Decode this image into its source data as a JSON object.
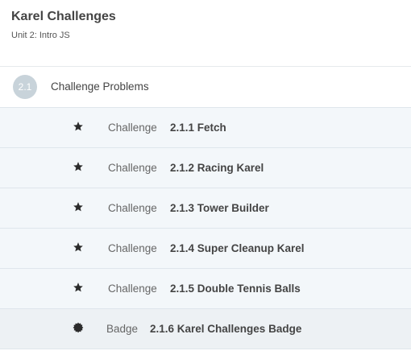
{
  "header": {
    "title": "Karel Challenges",
    "subtitle": "Unit 2: Intro JS"
  },
  "section": {
    "number": "2.1",
    "title": "Challenge Problems"
  },
  "items": [
    {
      "type": "Challenge",
      "name": "2.1.1 Fetch",
      "icon": "star-icon"
    },
    {
      "type": "Challenge",
      "name": "2.1.2 Racing Karel",
      "icon": "star-icon"
    },
    {
      "type": "Challenge",
      "name": "2.1.3 Tower Builder",
      "icon": "star-icon"
    },
    {
      "type": "Challenge",
      "name": "2.1.4 Super Cleanup Karel",
      "icon": "star-icon"
    },
    {
      "type": "Challenge",
      "name": "2.1.5 Double Tennis Balls",
      "icon": "star-icon"
    },
    {
      "type": "Badge",
      "name": "2.1.6 Karel Challenges Badge",
      "icon": "badge-seal-icon"
    }
  ],
  "colors": {
    "row_bg": "#f3f7fa",
    "section_badge_bg": "#c8d3da",
    "text_dark": "#444444"
  }
}
